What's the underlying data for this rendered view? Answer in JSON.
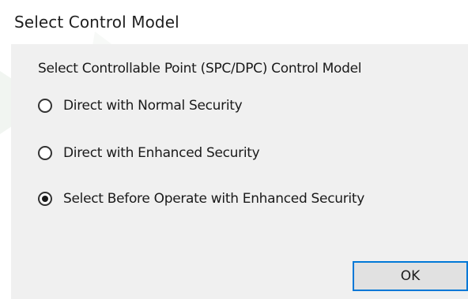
{
  "window": {
    "title": "Select Control Model"
  },
  "group": {
    "label": "Select Controllable Point (SPC/DPC) Control Model"
  },
  "options": [
    {
      "label": "Direct with Normal Security",
      "checked": false
    },
    {
      "label": "Direct with Enhanced Security",
      "checked": false
    },
    {
      "label": "Select Before Operate with Enhanced Security",
      "checked": true
    }
  ],
  "buttons": {
    "ok_label": "OK"
  },
  "colors": {
    "focus_border": "#0078d7",
    "client_bg": "#f0f0f0",
    "button_bg": "#e1e1e1"
  }
}
